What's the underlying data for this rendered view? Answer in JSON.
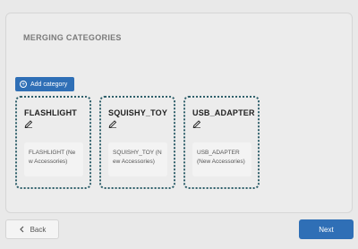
{
  "section": {
    "title": "MERGING CATEGORIES"
  },
  "toolbar": {
    "add_label": "Add category",
    "add_icon": "plus-circle-icon"
  },
  "categories": [
    {
      "name": "FLASHLIGHT",
      "edit_icon": "pencil-icon",
      "items": [
        "FLASHLIGHT (New Accessories)"
      ]
    },
    {
      "name": "SQUISHY_TOY",
      "edit_icon": "pencil-icon",
      "items": [
        "SQUISHY_TOY (New Accessories)"
      ]
    },
    {
      "name": "USB_ADAPTER",
      "edit_icon": "pencil-icon",
      "items": [
        "USB_ADAPTER (New Accessories)"
      ]
    }
  ],
  "footer": {
    "back_label": "Back",
    "back_icon": "chevron-left-icon",
    "next_label": "Next"
  },
  "colors": {
    "accent": "#2f6fb6",
    "card_border": "#2e5f6a",
    "background": "#ececec"
  }
}
